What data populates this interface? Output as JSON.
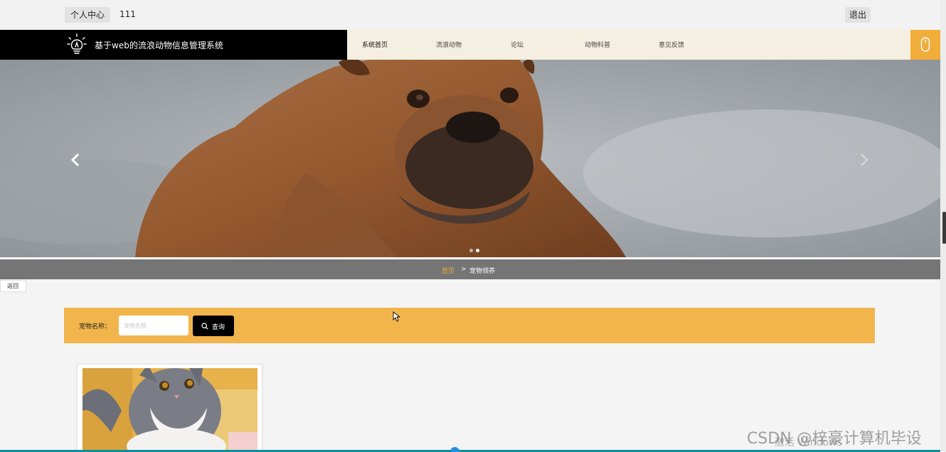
{
  "topbar": {
    "profile_label": "个人中心",
    "username": "111",
    "logout_label": "退出"
  },
  "nav": {
    "site_title": "基于web的流浪动物信息管理系统",
    "items": [
      {
        "label": "系统首页"
      },
      {
        "label": "流浪动物"
      },
      {
        "label": "论坛"
      },
      {
        "label": "动物科普"
      },
      {
        "label": "意见反馈"
      }
    ],
    "active_index": 0,
    "right_icon": "mouse-icon"
  },
  "banner": {
    "prev_icon": "chevron-left-icon",
    "next_icon": "chevron-right-icon",
    "slide_count": 2,
    "active_slide": 1
  },
  "breadcrumb": {
    "home": "首页",
    "separator": ">",
    "current": "宠物领养"
  },
  "back_label": "返回",
  "search": {
    "label": "宠物名称：",
    "placeholder": "宠物名称",
    "value": "",
    "button_label": "查询",
    "button_icon": "search-icon"
  },
  "watermark": {
    "text": "CSDN @梓豪计算机毕设",
    "under_text": "激活 Windows"
  },
  "colors": {
    "accent": "#f0ad3a",
    "search_bar": "#f1b54c",
    "brand_bg": "#000000",
    "menu_bg": "#f5efe1",
    "breadcrumb_bg": "#757575"
  }
}
